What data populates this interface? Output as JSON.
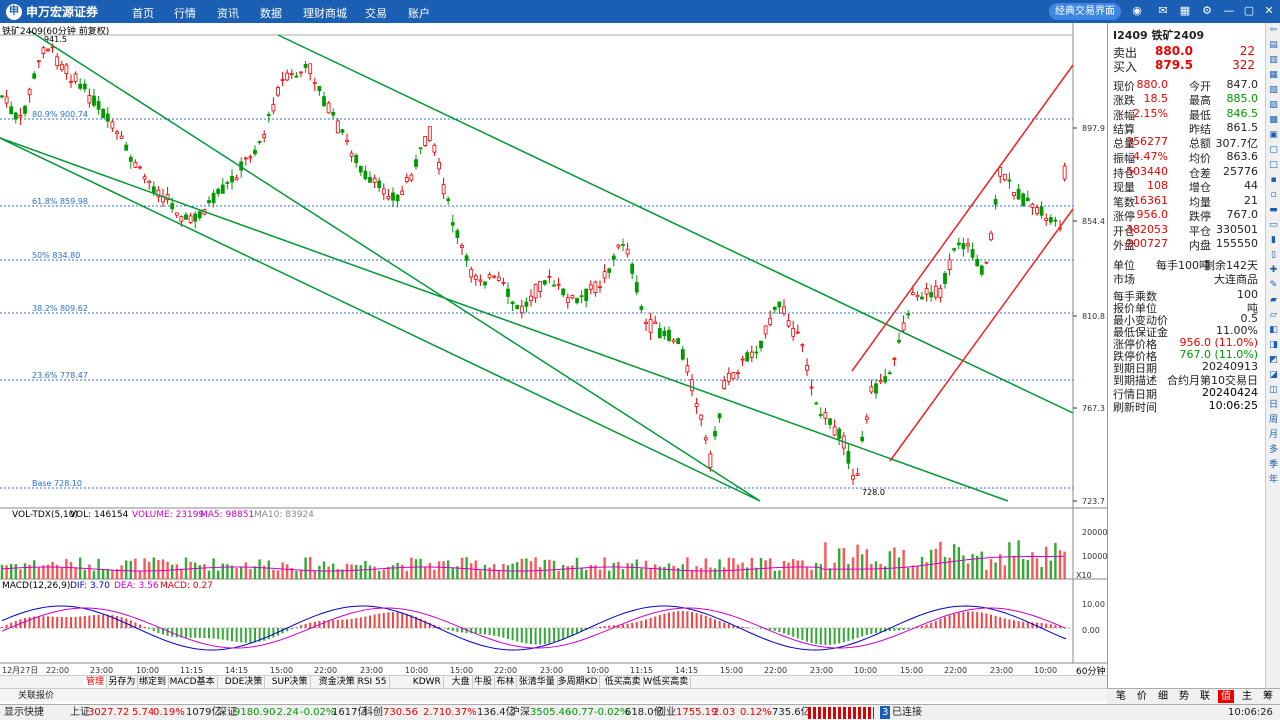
{
  "topbar": {
    "logo": "申万宏源证券",
    "nav": [
      "首页",
      "行情",
      "资讯",
      "数据",
      "理财商城",
      "交易",
      "账户"
    ],
    "classic": "经典交易界面"
  },
  "chart": {
    "title": "铁矿2409(60分钟 前复权)",
    "fib": [
      "80.9% 900.74",
      "61.8% 859.98",
      "50% 834.80",
      "38.2% 809.62",
      "23.6% 778.47",
      "Base 728.10"
    ],
    "high_label": "941.5",
    "low_label": "728.0",
    "price_axis": [
      "897.9",
      "854.4",
      "810.8",
      "767.3",
      "723.7"
    ],
    "vol_header": {
      "name": "VOL-TDX(5,10)",
      "vol": "VOL: 146154",
      "volume": "VOLUME: 23199",
      "ma5": "MA5: 98851",
      "ma10": "MA10: 83924"
    },
    "vol_axis": [
      "20000",
      "10000"
    ],
    "vol_scale": "X10",
    "macd_header": {
      "name": "MACD(12,26,9)",
      "dif": "DIF: 3.70",
      "dea": "DEA: 3.56",
      "macd": "MACD: 0.27"
    },
    "macd_axis": [
      "10.00",
      "0.00"
    ],
    "time_axis": [
      "12月27日",
      "22:00",
      "23:00",
      "10:00",
      "11:15",
      "14:15",
      "15:00",
      "22:00",
      "23:00",
      "10:00",
      "15:00",
      "22:00",
      "23:00",
      "10:00",
      "11:15",
      "14:15",
      "15:00",
      "22:00",
      "23:00",
      "10:00",
      "15:00",
      "22:00",
      "23:00",
      "10:00"
    ],
    "period": "60分钟"
  },
  "panel": {
    "title": "I2409 铁矿2409",
    "sell": {
      "label": "卖出",
      "price": "880.0",
      "qty": "22"
    },
    "buy": {
      "label": "买入",
      "price": "879.5",
      "qty": "322"
    },
    "rows1": [
      [
        "现价",
        "880.0",
        "今开",
        "847.0"
      ],
      [
        "涨跌",
        "18.5",
        "最高",
        "885.0"
      ],
      [
        "涨幅",
        "2.15%",
        "最低",
        "846.5"
      ],
      [
        "结算",
        "",
        "昨结",
        "861.5"
      ],
      [
        "总量",
        "356277",
        "总额",
        "307.7亿"
      ],
      [
        "振幅",
        "4.47%",
        "均价",
        "863.6"
      ]
    ],
    "rows2": [
      [
        "持仓",
        "503440",
        "仓差",
        "25776"
      ],
      [
        "现量",
        "108",
        "增仓",
        "44"
      ],
      [
        "笔数",
        "16361",
        "均量",
        "21"
      ],
      [
        "涨停",
        "956.0",
        "跌停",
        "767.0"
      ]
    ],
    "rows3": [
      [
        "开仓",
        "382053",
        "平仓",
        "330501"
      ],
      [
        "外盘",
        "200727",
        "内盘",
        "155550"
      ]
    ],
    "unit": {
      "label": "单位",
      "value": "每手100吨",
      "remain": "剩余142天"
    },
    "market": {
      "label": "市场",
      "value": "大连商品"
    },
    "info": [
      [
        "每手乘数",
        "100"
      ],
      [
        "报价单位",
        "吨"
      ],
      [
        "最小变动价",
        "0.5"
      ],
      [
        "最低保证金",
        "11.00%"
      ],
      [
        "涨停价格",
        "956.0 (11.0%)"
      ],
      [
        "跌停价格",
        "767.0 (11.0%)"
      ],
      [
        "到期日期",
        "20240913"
      ],
      [
        "到期描述",
        "合约月第10交易日"
      ]
    ],
    "date": {
      "label": "行情日期",
      "value": "20240424"
    },
    "refresh": {
      "label": "刷新时间",
      "value": "10:06:25"
    }
  },
  "side_tools": [
    "日",
    "周",
    "月",
    "多",
    "季",
    "年"
  ],
  "bottom_tabs": [
    "管理",
    "另存为",
    "绑定到",
    "MACD基本",
    "DDE决策",
    "SUP决策",
    "资金决策",
    "RSI 55",
    "KDWR",
    "大盘",
    "牛股",
    "布林",
    "张清华量",
    "多周期KD",
    "低买高卖",
    "W低买高卖"
  ],
  "related": "关联报价",
  "right_tabs": [
    "笔",
    "价",
    "细",
    "势",
    "联",
    "值",
    "主",
    "筹"
  ],
  "status": {
    "show": "显示快捷",
    "sh": "上证",
    "sh_v": "3027.72",
    "sh_c": "5.74",
    "sh_p": "0.19%",
    "sh_a": "1079亿",
    "sz": "深证",
    "sz_v": "9180.90",
    "sz_c": "-2.24",
    "sz_p": "-0.02%",
    "sz_a": "1617亿",
    "kc": "科创",
    "kc_v": "730.56",
    "kc_c": "2.71",
    "kc_p": "0.37%",
    "kc_a": "136.4亿",
    "hs": "沪深",
    "hs_v": "3505.46",
    "hs_c": "-0.77",
    "hs_p": "-0.02%",
    "hs_a": "618.0亿",
    "cy": "创业",
    "cy_v": "1755.19",
    "cy_c": "2.03",
    "cy_p": "0.12%",
    "cy_a": "735.6亿",
    "conn": "已连接",
    "time": "10:06:26"
  }
}
